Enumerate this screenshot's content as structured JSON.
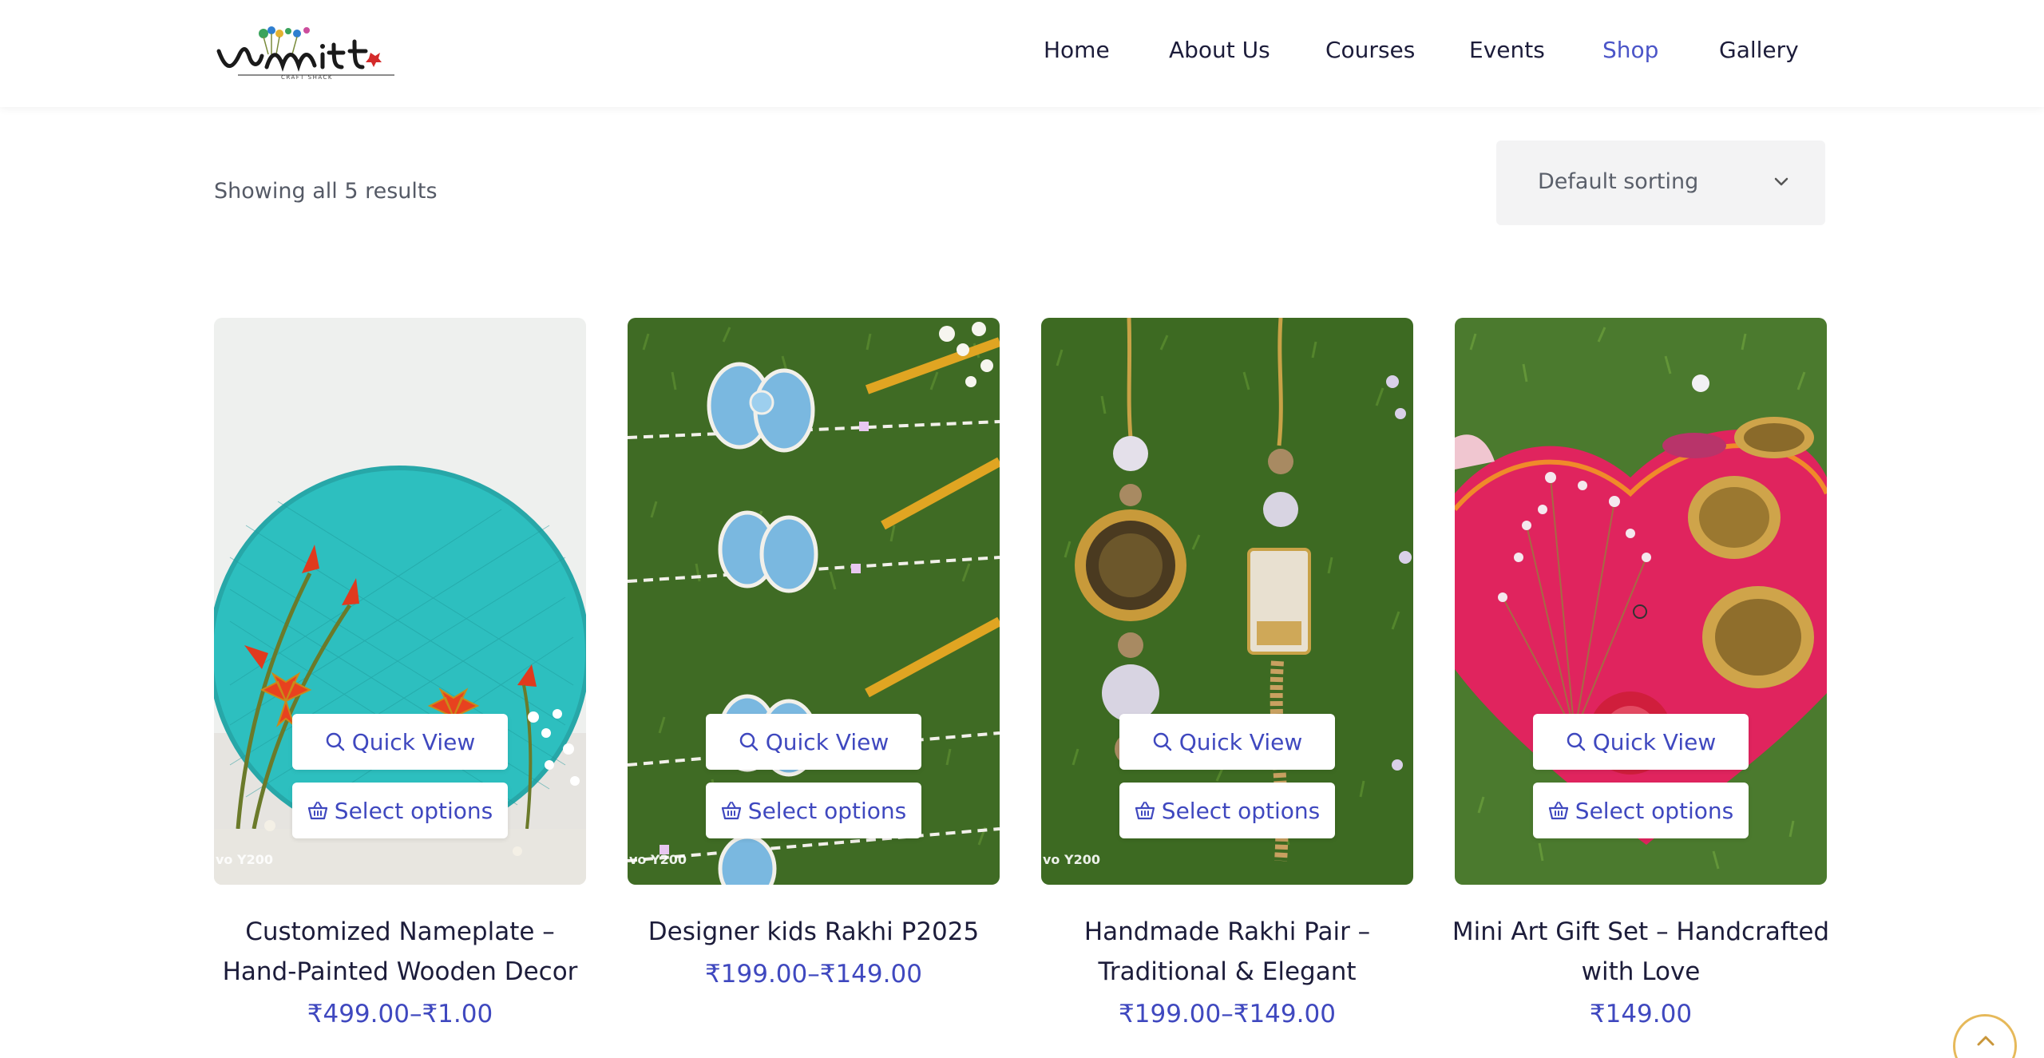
{
  "header": {
    "logo_text": "Vimitt",
    "logo_tagline": "CRAFT SHACK",
    "nav": [
      {
        "label": "Home"
      },
      {
        "label": "About Us"
      },
      {
        "label": "Courses"
      },
      {
        "label": "Events"
      },
      {
        "label": "Shop",
        "active": true
      },
      {
        "label": "Gallery"
      }
    ]
  },
  "toolbar": {
    "result_count": "Showing all 5 results",
    "sort_selected": "Default sorting"
  },
  "products": [
    {
      "title": "Customized Nameplate – Hand-Painted Wooden Decor",
      "price": "₹499.00–₹1.00",
      "quick_view": "Quick View",
      "select_options": "Select options",
      "watermark": "vo Y200"
    },
    {
      "title": "Designer kids Rakhi P2025",
      "price": "₹199.00–₹149.00",
      "quick_view": "Quick View",
      "select_options": "Select options",
      "watermark": "vo Y200"
    },
    {
      "title": "Handmade Rakhi Pair – Traditional & Elegant",
      "price": "₹199.00–₹149.00",
      "quick_view": "Quick View",
      "select_options": "Select options",
      "watermark": "vo Y200"
    },
    {
      "title": "Mini Art Gift Set – Handcrafted with Love",
      "price": "₹149.00",
      "quick_view": "Quick View",
      "select_options": "Select options",
      "watermark": ""
    }
  ],
  "colors": {
    "accent": "#3f48bf",
    "active_nav": "#4b55c8",
    "scroll_ring": "#e6b95a"
  },
  "icons": {
    "quick_view": "search-icon",
    "select_options": "basket-icon",
    "scroll_top": "chevron-up-icon",
    "sort": "chevron-down-icon"
  }
}
